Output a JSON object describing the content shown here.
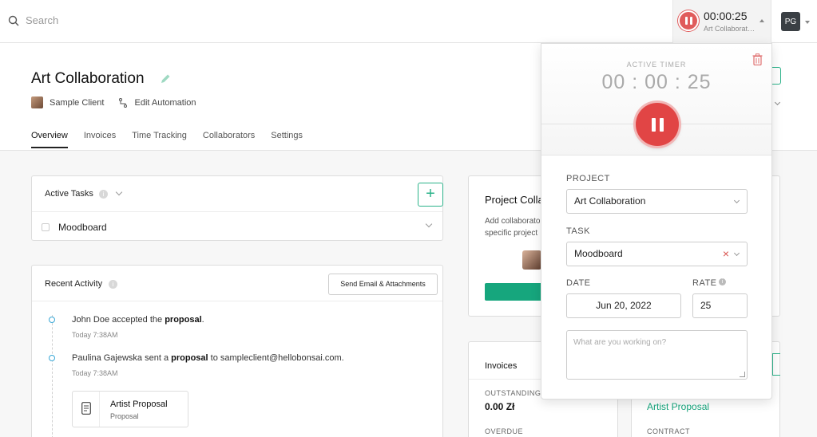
{
  "topbar": {
    "search_placeholder": "Search",
    "timer": {
      "time": "00:00:25",
      "project": "Art Collaboration"
    },
    "user_initials": "PG"
  },
  "project": {
    "title": "Art Collaboration",
    "client": "Sample Client",
    "edit_automation": "Edit Automation",
    "tabs": [
      {
        "label": "Overview",
        "active": true
      },
      {
        "label": "Invoices"
      },
      {
        "label": "Time Tracking"
      },
      {
        "label": "Collaborators"
      },
      {
        "label": "Settings"
      }
    ]
  },
  "active_tasks": {
    "title": "Active Tasks",
    "add": "+",
    "tasks": [
      {
        "name": "Moodboard"
      }
    ]
  },
  "recent_activity": {
    "title": "Recent Activity",
    "send_button": "Send Email & Attachments",
    "items": [
      {
        "pre": "John Doe accepted the ",
        "bold": "proposal",
        "post": ".",
        "time": "Today 7:38AM"
      },
      {
        "pre": "Paulina Gajewska sent a ",
        "bold": "proposal",
        "post": " to sampleclient@hellobonsai.com.",
        "time": "Today 7:38AM"
      }
    ],
    "attachment": {
      "title": "Artist Proposal",
      "subtitle": "Proposal"
    }
  },
  "collaborators": {
    "title": "Project Colla",
    "desc_line1": "Add collaborato",
    "desc_line2": "specific project"
  },
  "invoices": {
    "title": "Invoices",
    "outstanding_label": "OUTSTANDING",
    "outstanding_value": "0.00 Zł",
    "overdue_label": "OVERDUE"
  },
  "contract": {
    "link": "Artist Proposal",
    "label": "CONTRACT"
  },
  "timer_popup": {
    "label": "ACTIVE TIMER",
    "h": "00",
    "m": "00",
    "s": "25",
    "project_label": "PROJECT",
    "project_value": "Art Collaboration",
    "task_label": "TASK",
    "task_value": "Moodboard",
    "date_label": "DATE",
    "date_value": "Jun 20, 2022",
    "rate_label": "RATE",
    "rate_value": "25",
    "notes_placeholder": "What are you working on?"
  },
  "colors": {
    "accent": "#2bb38a",
    "timer_red": "#e14545",
    "link_blue": "#3aa7d6"
  }
}
